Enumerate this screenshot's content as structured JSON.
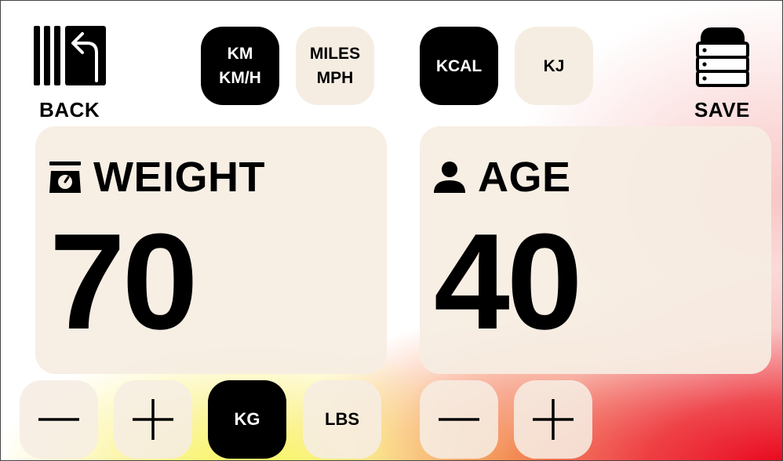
{
  "toolbar": {
    "back_label": "BACK",
    "save_label": "SAVE",
    "distance_units": [
      {
        "line1": "KM",
        "line2": "KM/H",
        "selected": true
      },
      {
        "line1": "MILES",
        "line2": "MPH",
        "selected": false
      }
    ],
    "energy_units": [
      {
        "label": "KCAL",
        "selected": true
      },
      {
        "label": "KJ",
        "selected": false
      }
    ]
  },
  "weight": {
    "title": "WEIGHT",
    "icon": "scale-icon",
    "value": "70",
    "units": [
      {
        "label": "KG",
        "selected": true
      },
      {
        "label": "LBS",
        "selected": false
      }
    ]
  },
  "age": {
    "title": "AGE",
    "icon": "person-icon",
    "value": "40"
  },
  "colors": {
    "selected_bg": "#000000",
    "unselected_bg": "#f6ede2",
    "accent_red": "#e80018",
    "accent_yellow": "#f8f65a"
  }
}
